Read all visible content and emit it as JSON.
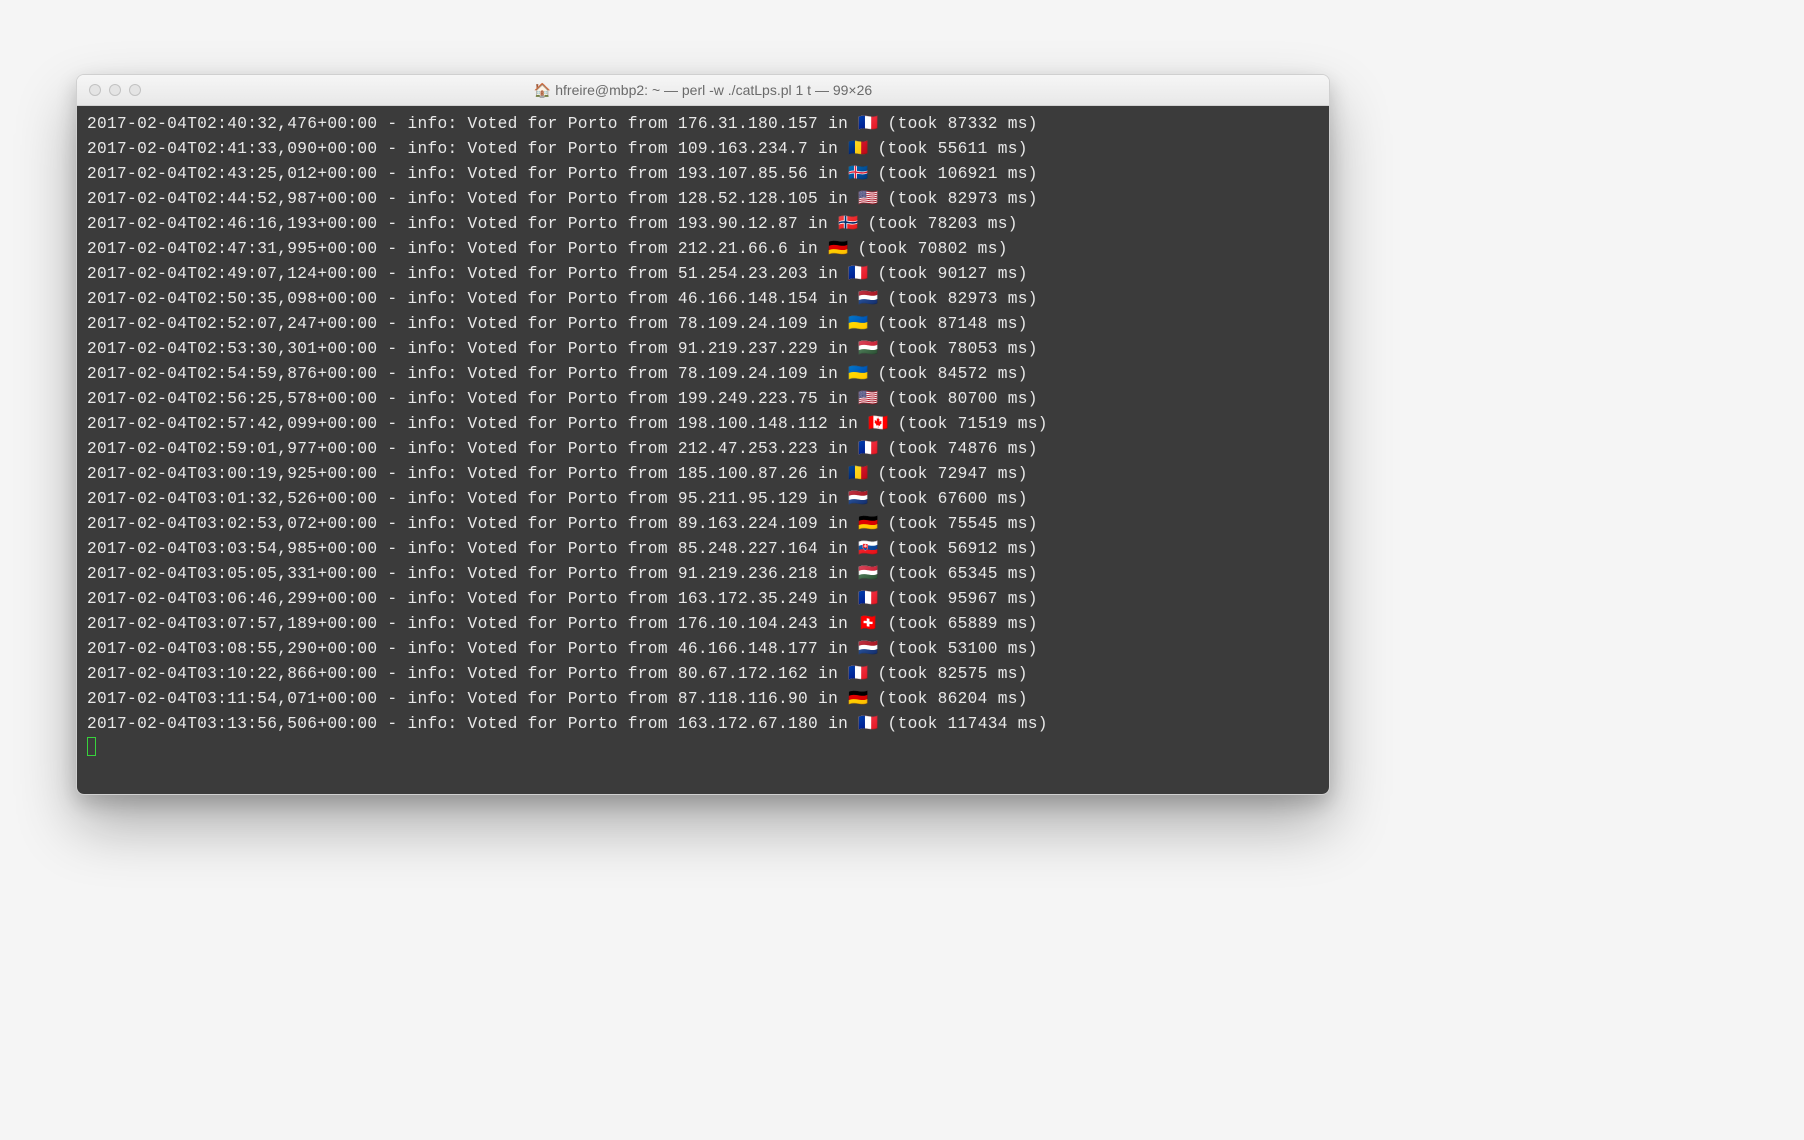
{
  "window": {
    "title_prefix_icon": "home-icon",
    "title": "hfreire@mbp2: ~ — perl -w ./catLps.pl 1 t — 99×26"
  },
  "terminal": {
    "prefix_message": "info: Voted for Porto from ",
    "lines": [
      {
        "ts": "2017-02-04T02:40:32,476+00:00",
        "ip": "176.31.180.157",
        "flag": "🇫🇷",
        "ms": "87332"
      },
      {
        "ts": "2017-02-04T02:41:33,090+00:00",
        "ip": "109.163.234.7",
        "flag": "🇷🇴",
        "ms": "55611"
      },
      {
        "ts": "2017-02-04T02:43:25,012+00:00",
        "ip": "193.107.85.56",
        "flag": "🇮🇸",
        "ms": "106921"
      },
      {
        "ts": "2017-02-04T02:44:52,987+00:00",
        "ip": "128.52.128.105",
        "flag": "🇺🇸",
        "ms": "82973"
      },
      {
        "ts": "2017-02-04T02:46:16,193+00:00",
        "ip": "193.90.12.87",
        "flag": "🇳🇴",
        "ms": "78203"
      },
      {
        "ts": "2017-02-04T02:47:31,995+00:00",
        "ip": "212.21.66.6",
        "flag": "🇩🇪",
        "ms": "70802"
      },
      {
        "ts": "2017-02-04T02:49:07,124+00:00",
        "ip": "51.254.23.203",
        "flag": "🇫🇷",
        "ms": "90127"
      },
      {
        "ts": "2017-02-04T02:50:35,098+00:00",
        "ip": "46.166.148.154",
        "flag": "🇳🇱",
        "ms": "82973"
      },
      {
        "ts": "2017-02-04T02:52:07,247+00:00",
        "ip": "78.109.24.109",
        "flag": "🇺🇦",
        "ms": "87148"
      },
      {
        "ts": "2017-02-04T02:53:30,301+00:00",
        "ip": "91.219.237.229",
        "flag": "🇭🇺",
        "ms": "78053"
      },
      {
        "ts": "2017-02-04T02:54:59,876+00:00",
        "ip": "78.109.24.109",
        "flag": "🇺🇦",
        "ms": "84572"
      },
      {
        "ts": "2017-02-04T02:56:25,578+00:00",
        "ip": "199.249.223.75",
        "flag": "🇺🇸",
        "ms": "80700"
      },
      {
        "ts": "2017-02-04T02:57:42,099+00:00",
        "ip": "198.100.148.112",
        "flag": "🇨🇦",
        "ms": "71519"
      },
      {
        "ts": "2017-02-04T02:59:01,977+00:00",
        "ip": "212.47.253.223",
        "flag": "🇫🇷",
        "ms": "74876"
      },
      {
        "ts": "2017-02-04T03:00:19,925+00:00",
        "ip": "185.100.87.26",
        "flag": "🇷🇴",
        "ms": "72947"
      },
      {
        "ts": "2017-02-04T03:01:32,526+00:00",
        "ip": "95.211.95.129",
        "flag": "🇳🇱",
        "ms": "67600"
      },
      {
        "ts": "2017-02-04T03:02:53,072+00:00",
        "ip": "89.163.224.109",
        "flag": "🇩🇪",
        "ms": "75545"
      },
      {
        "ts": "2017-02-04T03:03:54,985+00:00",
        "ip": "85.248.227.164",
        "flag": "🇸🇰",
        "ms": "56912"
      },
      {
        "ts": "2017-02-04T03:05:05,331+00:00",
        "ip": "91.219.236.218",
        "flag": "🇭🇺",
        "ms": "65345"
      },
      {
        "ts": "2017-02-04T03:06:46,299+00:00",
        "ip": "163.172.35.249",
        "flag": "🇫🇷",
        "ms": "95967"
      },
      {
        "ts": "2017-02-04T03:07:57,189+00:00",
        "ip": "176.10.104.243",
        "flag": "🇨🇭",
        "ms": "65889"
      },
      {
        "ts": "2017-02-04T03:08:55,290+00:00",
        "ip": "46.166.148.177",
        "flag": "🇳🇱",
        "ms": "53100"
      },
      {
        "ts": "2017-02-04T03:10:22,866+00:00",
        "ip": "80.67.172.162",
        "flag": "🇫🇷",
        "ms": "82575"
      },
      {
        "ts": "2017-02-04T03:11:54,071+00:00",
        "ip": "87.118.116.90",
        "flag": "🇩🇪",
        "ms": "86204"
      },
      {
        "ts": "2017-02-04T03:13:56,506+00:00",
        "ip": "163.172.67.180",
        "flag": "🇫🇷",
        "ms": "117434"
      }
    ]
  }
}
